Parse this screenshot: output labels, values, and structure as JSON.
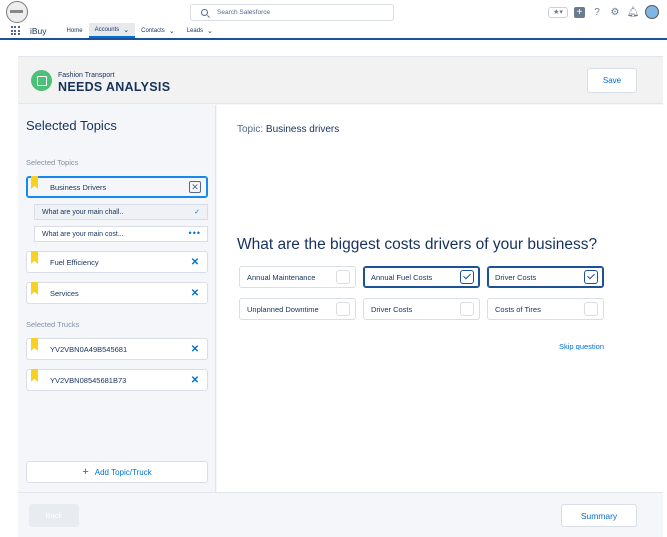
{
  "header": {
    "search_placeholder": "Search Salesforce",
    "icons": [
      "favorites-icon",
      "add-icon",
      "help-icon",
      "setup-icon",
      "notifications-icon",
      "user-avatar"
    ]
  },
  "nav": {
    "app_name": "iBuy",
    "items": [
      {
        "label": "Home",
        "has_menu": false,
        "active": false
      },
      {
        "label": "Accounts",
        "has_menu": true,
        "active": true
      },
      {
        "label": "Contacts",
        "has_menu": true,
        "active": false
      },
      {
        "label": "Leads",
        "has_menu": true,
        "active": false
      }
    ]
  },
  "page": {
    "subtitle": "Fashion Transport",
    "title": "NEEDS ANALYSIS",
    "save_label": "Save"
  },
  "left": {
    "title": "Selected Topics",
    "topics_section": "Selected Topics",
    "topics": [
      {
        "label": "Business Drivers",
        "selected": true
      },
      {
        "label": "Fuel Efficiency",
        "selected": false
      },
      {
        "label": "Services",
        "selected": false
      }
    ],
    "questions": [
      {
        "label": "What are your main chall..",
        "status": "answered"
      },
      {
        "label": "What are your main cost...",
        "status": "in-progress"
      }
    ],
    "trucks_section": "Selected Trucks",
    "trucks": [
      "YV2VBN0A49B545681",
      "YV2VBN08545681B73"
    ],
    "add_label": "Add Topic/Truck"
  },
  "right": {
    "topic_prefix": "Topic:",
    "topic_name": "Business drivers",
    "question": "What are the biggest costs drivers of your business?",
    "options": [
      {
        "label": "Annual Maintenance",
        "checked": false
      },
      {
        "label": "Annual Fuel Costs",
        "checked": true
      },
      {
        "label": "Driver Costs",
        "checked": true
      },
      {
        "label": "Unplanned Downtime",
        "checked": false
      },
      {
        "label": "Driver Costs",
        "checked": false
      },
      {
        "label": "Costs of Tires",
        "checked": false
      }
    ],
    "skip_label": "Skip question"
  },
  "footer": {
    "back_label": "Back",
    "summary_label": "Summary"
  },
  "colors": {
    "brand_blue": "#0070d2",
    "nav_underline": "#1b5297",
    "record_icon": "#4bc076",
    "flag": "#f9d122"
  }
}
